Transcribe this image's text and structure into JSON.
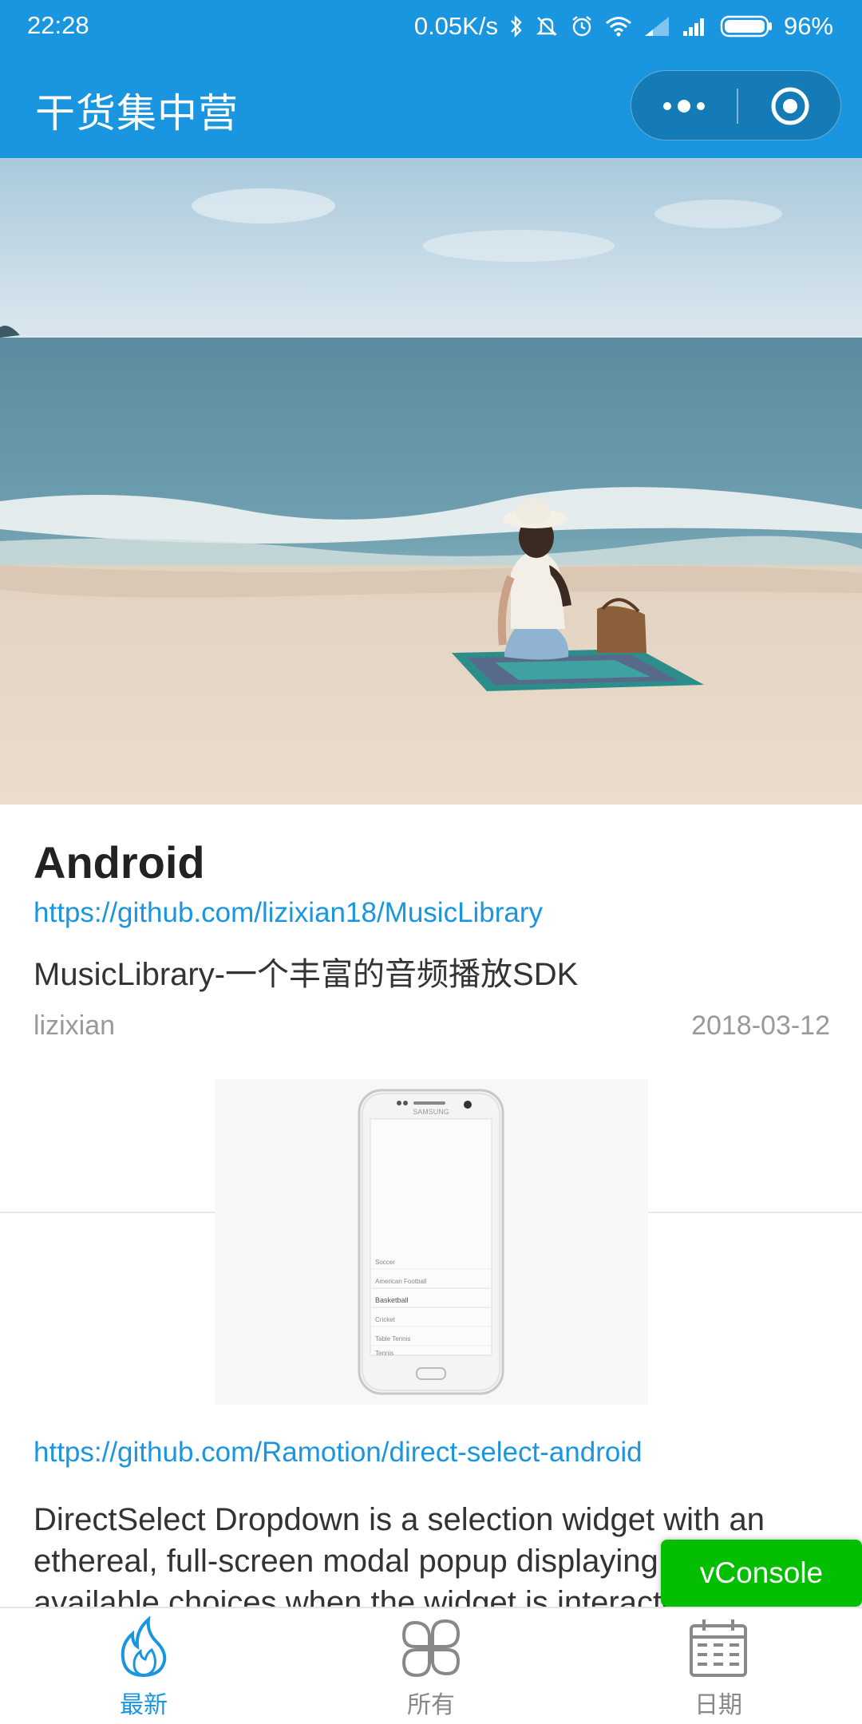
{
  "status_bar": {
    "time": "22:28",
    "net_speed": "0.05K/s",
    "battery": "96%"
  },
  "title_bar": {
    "title": "干货集中营"
  },
  "articles": [
    {
      "category": "Android",
      "url": "https://github.com/lizixian18/MusicLibrary",
      "description": "MusicLibrary-一个丰富的音频播放SDK",
      "author": "lizixian",
      "date": "2018-03-12"
    },
    {
      "url": "https://github.com/Ramotion/direct-select-android",
      "description": "DirectSelect Dropdown is a selection widget with an ethereal, full-screen modal popup displaying the available choices when the widget is interacted with.",
      "phone_brand": "SAMSUNG",
      "phone_list": [
        "Soccer",
        "American Football",
        "Basketball",
        "Cricket",
        "Table Tennis",
        "Tennis"
      ]
    }
  ],
  "vconsole": {
    "label": "vConsole"
  },
  "tab_bar": {
    "tabs": [
      {
        "label": "最新",
        "icon": "flame-icon",
        "active": true
      },
      {
        "label": "所有",
        "icon": "clover-icon",
        "active": false
      },
      {
        "label": "日期",
        "icon": "calendar-icon",
        "active": false
      }
    ]
  },
  "colors": {
    "primary": "#1a96e0",
    "vconsole": "#04be02",
    "muted": "#999999"
  }
}
